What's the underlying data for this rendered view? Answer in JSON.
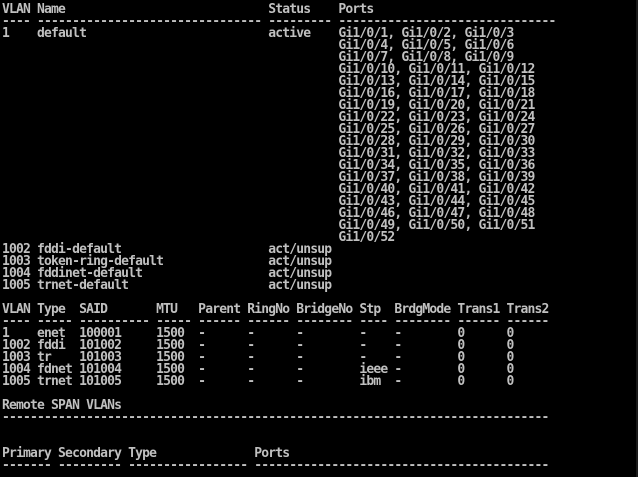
{
  "terminal": {
    "lines": [
      "VLAN Name                             Status    Ports",
      "---- -------------------------------- --------- -------------------------------",
      "1    default                          active    Gi1/0/1, Gi1/0/2, Gi1/0/3",
      "                                                Gi1/0/4, Gi1/0/5, Gi1/0/6",
      "                                                Gi1/0/7, Gi1/0/8, Gi1/0/9",
      "                                                Gi1/0/10, Gi1/0/11, Gi1/0/12",
      "                                                Gi1/0/13, Gi1/0/14, Gi1/0/15",
      "                                                Gi1/0/16, Gi1/0/17, Gi1/0/18",
      "                                                Gi1/0/19, Gi1/0/20, Gi1/0/21",
      "                                                Gi1/0/22, Gi1/0/23, Gi1/0/24",
      "                                                Gi1/0/25, Gi1/0/26, Gi1/0/27",
      "                                                Gi1/0/28, Gi1/0/29, Gi1/0/30",
      "                                                Gi1/0/31, Gi1/0/32, Gi1/0/33",
      "                                                Gi1/0/34, Gi1/0/35, Gi1/0/36",
      "                                                Gi1/0/37, Gi1/0/38, Gi1/0/39",
      "                                                Gi1/0/40, Gi1/0/41, Gi1/0/42",
      "                                                Gi1/0/43, Gi1/0/44, Gi1/0/45",
      "                                                Gi1/0/46, Gi1/0/47, Gi1/0/48",
      "                                                Gi1/0/49, Gi1/0/50, Gi1/0/51",
      "                                                Gi1/0/52",
      "1002 fddi-default                     act/unsup",
      "1003 token-ring-default               act/unsup",
      "1004 fddinet-default                  act/unsup",
      "1005 trnet-default                    act/unsup",
      "",
      "VLAN Type  SAID       MTU   Parent RingNo BridgeNo Stp  BrdgMode Trans1 Trans2",
      "---- ----- ---------- ----- ------ ------ -------- ---- -------- ------ ------",
      "1    enet  100001     1500  -      -      -        -    -        0      0",
      "1002 fddi  101002     1500  -      -      -        -    -        0      0",
      "1003 tr    101003     1500  -      -      -        -    -        0      0",
      "1004 fdnet 101004     1500  -      -      -        ieee -        0      0",
      "1005 trnet 101005     1500  -      -      -        ibm  -        0      0",
      "",
      "Remote SPAN VLANs",
      "------------------------------------------------------------------------------",
      "",
      "",
      "Primary Secondary Type              Ports",
      "------- --------- ----------------- ------------------------------------------"
    ]
  }
}
